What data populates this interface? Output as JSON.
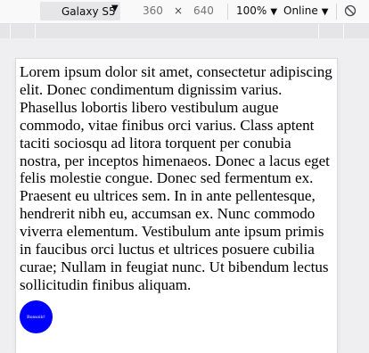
{
  "toolbar": {
    "device": "Galaxy S5",
    "width": "360",
    "times": "×",
    "height": "640",
    "zoom": "100%",
    "network": "Online",
    "icons": {
      "device_dropdown": "caret-down-icon",
      "zoom_dropdown": "caret-down-icon",
      "network_dropdown": "caret-down-icon",
      "rotate": "rotate-icon"
    }
  },
  "page": {
    "paragraph": "Lorem ipsum dolor sit amet, consectetur adipiscing elit. Donec condimentum dignissim varius. Phasellus lobortis libero vestibulum augue commodo, vitae finibus orci varius. Class aptent taciti sociosqu ad litora torquent per conubia nostra, per inceptos himenaeos. Donec a lacus eget felis molestie congue. Donec sed fermentum ex. Praesent eu ultrices sem. In in ante pellentesque, hendrerit nibh eu, accumsan ex. Nunc commodo viverra elementum. Vestibulum ante ipsum primis in faucibus orci luctus et ultrices posuere cubilia curae; Nullam in feugiat nunc. Ut bibendum lectus sollicitudin finibus aliquam.",
    "button_label": "Bonsoiir!",
    "button_color": "#0000ff"
  }
}
